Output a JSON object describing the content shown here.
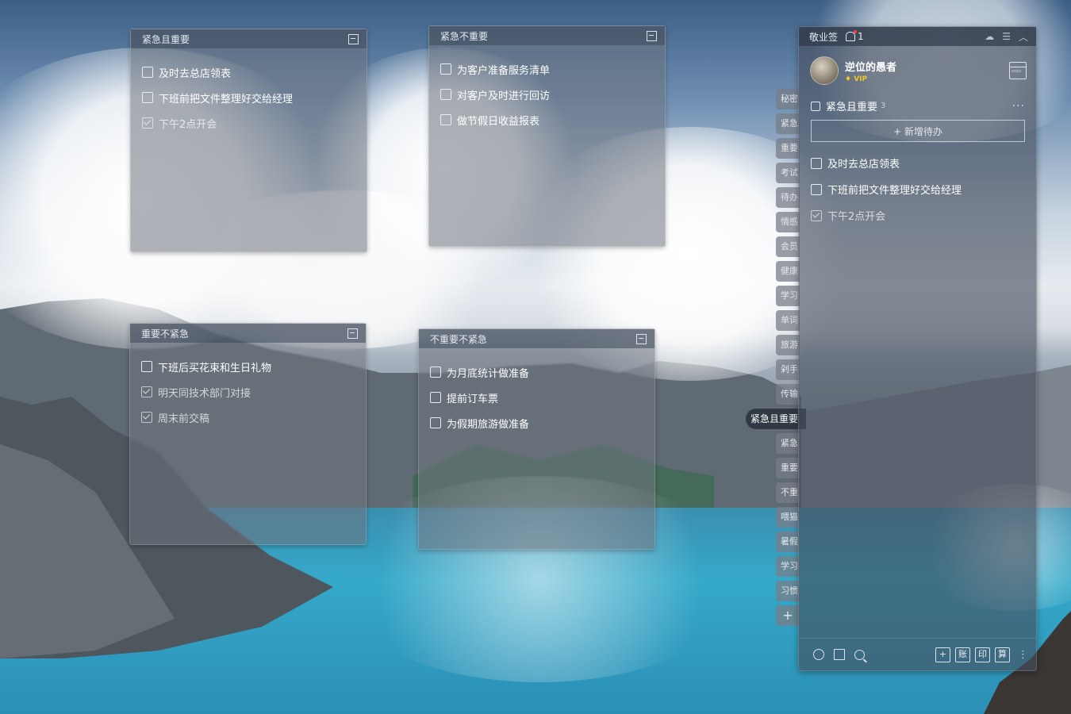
{
  "notes": [
    {
      "title": "紧急且重要",
      "items": [
        {
          "text": "及时去总店领表",
          "done": false
        },
        {
          "text": "下班前把文件整理好交给经理",
          "done": false
        },
        {
          "text": "下午2点开会",
          "done": true
        }
      ]
    },
    {
      "title": "紧急不重要",
      "items": [
        {
          "text": "为客户准备服务清单",
          "done": false
        },
        {
          "text": "对客户及时进行回访",
          "done": false
        },
        {
          "text": "做节假日收益报表",
          "done": false
        }
      ]
    },
    {
      "title": "重要不紧急",
      "items": [
        {
          "text": "下班后买花束和生日礼物",
          "done": false
        },
        {
          "text": "明天同技术部门对接",
          "done": true
        },
        {
          "text": "周末前交稿",
          "done": true
        }
      ]
    },
    {
      "title": "不重要不紧急",
      "items": [
        {
          "text": "为月底统计做准备",
          "done": false
        },
        {
          "text": "提前订车票",
          "done": false
        },
        {
          "text": "为假期旅游做准备",
          "done": false
        }
      ]
    }
  ],
  "side_tabs": [
    "秘密",
    "紧急",
    "重要",
    "考试",
    "待办",
    "情感",
    "会员",
    "健康",
    "学习",
    "单词",
    "旅游",
    "剁手",
    "传输",
    "紧急且重要",
    "紧急",
    "重要",
    "不重",
    "喂猫",
    "暑假",
    "学习",
    "习惯"
  ],
  "active_tab_index": 13,
  "add_tab_label": "+",
  "panel": {
    "app_name": "敬业签",
    "notification_count": "1",
    "user_name": "逆位的愚者",
    "vip_label": "VIP",
    "list_title": "紧急且重要",
    "list_count": "3",
    "more_label": "···",
    "add_todo_label": "+ 新增待办",
    "items": [
      {
        "text": "及时去总店领表",
        "done": false
      },
      {
        "text": "下班前把文件整理好交给经理",
        "done": false
      },
      {
        "text": "下午2点开会",
        "done": true
      }
    ],
    "toolbar": {
      "plus": "+",
      "account": "账",
      "print": "印",
      "calc": "算",
      "more": "⋮"
    },
    "top_icons": {
      "cloud": "☁",
      "menu": "☰",
      "collapse": "︿"
    }
  },
  "colors": {
    "vip": "#f3c623",
    "badge": "#ff4040"
  }
}
